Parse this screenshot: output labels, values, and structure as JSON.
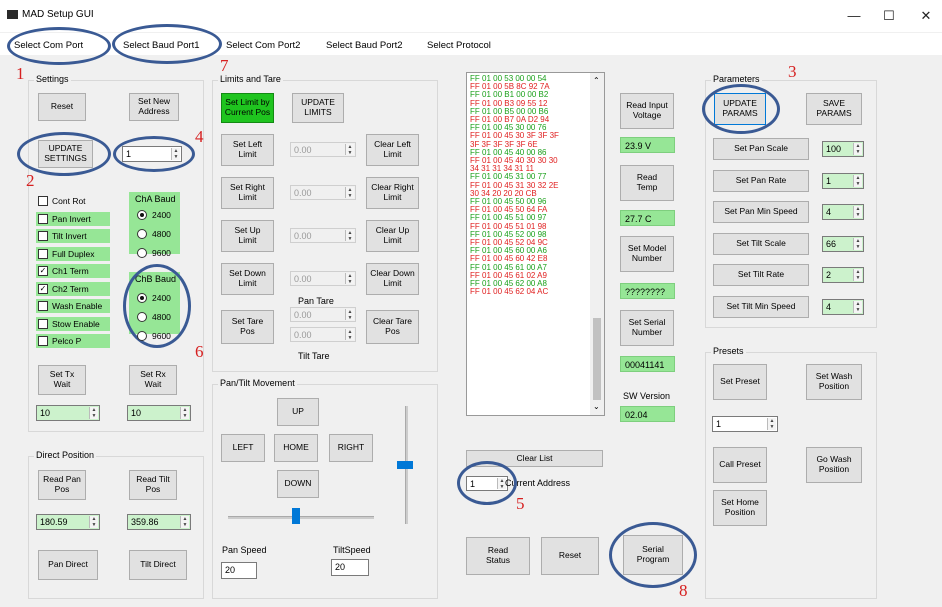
{
  "window": {
    "title": "MAD Setup GUI",
    "minimize": "—",
    "maximize": "☐",
    "close": "✕"
  },
  "menu": [
    "Select Com Port",
    "Select Baud Port1",
    "Select Com Port2",
    "Select Baud Port2",
    "Select Protocol"
  ],
  "settings": {
    "label": "Settings",
    "reset": "Reset",
    "set_new_address": "Set New\nAddress",
    "update_settings": "UPDATE\nSETTINGS",
    "address_value": "1",
    "checks": [
      {
        "label": "Cont Rot",
        "checked": false,
        "green": false
      },
      {
        "label": "Pan Invert",
        "checked": false,
        "green": true
      },
      {
        "label": "Tilt Invert",
        "checked": false,
        "green": true
      },
      {
        "label": "Full Duplex",
        "checked": false,
        "green": true
      },
      {
        "label": "Ch1 Term",
        "checked": true,
        "green": true
      },
      {
        "label": "Ch2 Term",
        "checked": true,
        "green": true
      },
      {
        "label": "Wash Enable",
        "checked": false,
        "green": true
      },
      {
        "label": "Stow Enable",
        "checked": false,
        "green": true
      },
      {
        "label": "Pelco P",
        "checked": false,
        "green": true
      }
    ],
    "cha_label": "ChA Baud",
    "cha_opts": [
      "2400",
      "4800",
      "9600"
    ],
    "cha_selected": 0,
    "chb_label": "ChB Baud",
    "chb_opts": [
      "2400",
      "4800",
      "9600"
    ],
    "chb_selected": 0,
    "set_tx_wait": "Set Tx\nWait",
    "set_rx_wait": "Set Rx\nWait",
    "tx_value": "10",
    "rx_value": "10"
  },
  "direct": {
    "label": "Direct Position",
    "read_pan": "Read Pan\nPos",
    "read_tilt": "Read Tilt\nPos",
    "pan_value": "180.59",
    "tilt_value": "359.86",
    "pan_direct": "Pan Direct",
    "tilt_direct": "Tilt Direct"
  },
  "limits": {
    "label": "Limits and Tare",
    "set_limit": "Set Limit by\nCurrent Pos",
    "update_limits": "UPDATE\nLIMITS",
    "rows": [
      {
        "set": "Set Left\nLimit",
        "value": "0.00",
        "clear": "Clear Left\nLimit"
      },
      {
        "set": "Set Right\nLimit",
        "value": "0.00",
        "clear": "Clear Right\nLimit"
      },
      {
        "set": "Set Up\nLimit",
        "value": "0.00",
        "clear": "Clear Up\nLimit"
      },
      {
        "set": "Set Down\nLimit",
        "value": "0.00",
        "clear": "Clear Down\nLimit"
      }
    ],
    "pan_tare": "Pan Tare",
    "tilt_tare": "Tilt Tare",
    "set_tare": "Set Tare\nPos",
    "pan_tare_value": "0.00",
    "tilt_tare_value": "0.00",
    "clear_tare": "Clear Tare\nPos"
  },
  "movement": {
    "label": "Pan/Tilt Movement",
    "up": "UP",
    "left": "LEFT",
    "home": "HOME",
    "right": "RIGHT",
    "down": "DOWN",
    "pan_speed_label": "Pan Speed",
    "tilt_speed_label": "TiltSpeed",
    "pan_speed": "20",
    "tilt_speed": "20"
  },
  "serial_log": [
    {
      "t": "FF 01 00 53 00 00 54",
      "c": "#1aa01a"
    },
    {
      "t": "FF 01 00 5B 8C 92 7A",
      "c": "#e02020"
    },
    {
      "t": "FF 01 00 B1 00 00 B2",
      "c": "#1aa01a"
    },
    {
      "t": "FF 01 00 B3 09 55 12",
      "c": "#e02020"
    },
    {
      "t": "FF 01 00 B5 00 00 B6",
      "c": "#1aa01a"
    },
    {
      "t": "FF 01 00 B7 0A D2 94",
      "c": "#e02020"
    },
    {
      "t": "FF 01 00 45 30 00 76",
      "c": "#1aa01a"
    },
    {
      "t": "FF 01 00 45 30 3F 3F 3F",
      "c": "#e02020"
    },
    {
      "t": "3F 3F 3F 3F 3F 6E",
      "c": "#e02020"
    },
    {
      "t": "FF 01 00 45 40 00 86",
      "c": "#1aa01a"
    },
    {
      "t": "FF 01 00 45 40 30 30 30",
      "c": "#e02020"
    },
    {
      "t": "34 31 31 34 31 11",
      "c": "#e02020"
    },
    {
      "t": "FF 01 00 45 31 00 77",
      "c": "#1aa01a"
    },
    {
      "t": "FF 01 00 45 31 30 32 2E",
      "c": "#e02020"
    },
    {
      "t": "30 34 20 20 20 CB",
      "c": "#e02020"
    },
    {
      "t": "FF 01 00 45 50 00 96",
      "c": "#1aa01a"
    },
    {
      "t": "FF 01 00 45 50 64 FA",
      "c": "#e02020"
    },
    {
      "t": "FF 01 00 45 51 00 97",
      "c": "#1aa01a"
    },
    {
      "t": "FF 01 00 45 51 01 98",
      "c": "#e02020"
    },
    {
      "t": "FF 01 00 45 52 00 98",
      "c": "#1aa01a"
    },
    {
      "t": "FF 01 00 45 52 04 9C",
      "c": "#e02020"
    },
    {
      "t": "FF 01 00 45 60 00 A6",
      "c": "#1aa01a"
    },
    {
      "t": "FF 01 00 45 60 42 E8",
      "c": "#e02020"
    },
    {
      "t": "FF 01 00 45 61 00 A7",
      "c": "#1aa01a"
    },
    {
      "t": "FF 01 00 45 61 02 A9",
      "c": "#e02020"
    },
    {
      "t": "FF 01 00 45 62 00 A8",
      "c": "#1aa01a"
    },
    {
      "t": "FF 01 00 45 62 04 AC",
      "c": "#e02020"
    }
  ],
  "log_controls": {
    "clear_list": "Clear List",
    "current_address_label": "Current Address",
    "current_address": "1",
    "read_status": "Read\nStatus",
    "reset": "Reset",
    "serial_program": "Serial\nProgram"
  },
  "info": {
    "read_input_voltage": "Read Input\nVoltage",
    "voltage": "23.9 V",
    "read_temp": "Read\nTemp",
    "temp": "27.7 C",
    "set_model_number": "Set Model\nNumber",
    "model": "????????",
    "set_serial_number": "Set Serial\nNumber",
    "serial": "00041141",
    "sw_version_label": "SW Version",
    "sw_version": "02.04"
  },
  "parameters": {
    "label": "Parameters",
    "update_params": "UPDATE\nPARAMS",
    "save_params": "SAVE\nPARAMS",
    "rows": [
      {
        "label": "Set Pan Scale",
        "value": "100"
      },
      {
        "label": "Set Pan Rate",
        "value": "1"
      },
      {
        "label": "Set Pan Min Speed",
        "value": "4"
      },
      {
        "label": "Set Tilt Scale",
        "value": "66"
      },
      {
        "label": "Set Tilt Rate",
        "value": "2"
      },
      {
        "label": "Set Tilt Min Speed",
        "value": "4"
      }
    ]
  },
  "presets": {
    "label": "Presets",
    "set_preset": "Set Preset",
    "set_wash_position": "Set Wash\nPosition",
    "preset_value": "1",
    "call_preset": "Call Preset",
    "go_wash_position": "Go Wash\nPosition",
    "set_home_position": "Set Home\nPosition"
  },
  "annotations": [
    "1",
    "2",
    "3",
    "4",
    "5",
    "6",
    "7",
    "8"
  ]
}
